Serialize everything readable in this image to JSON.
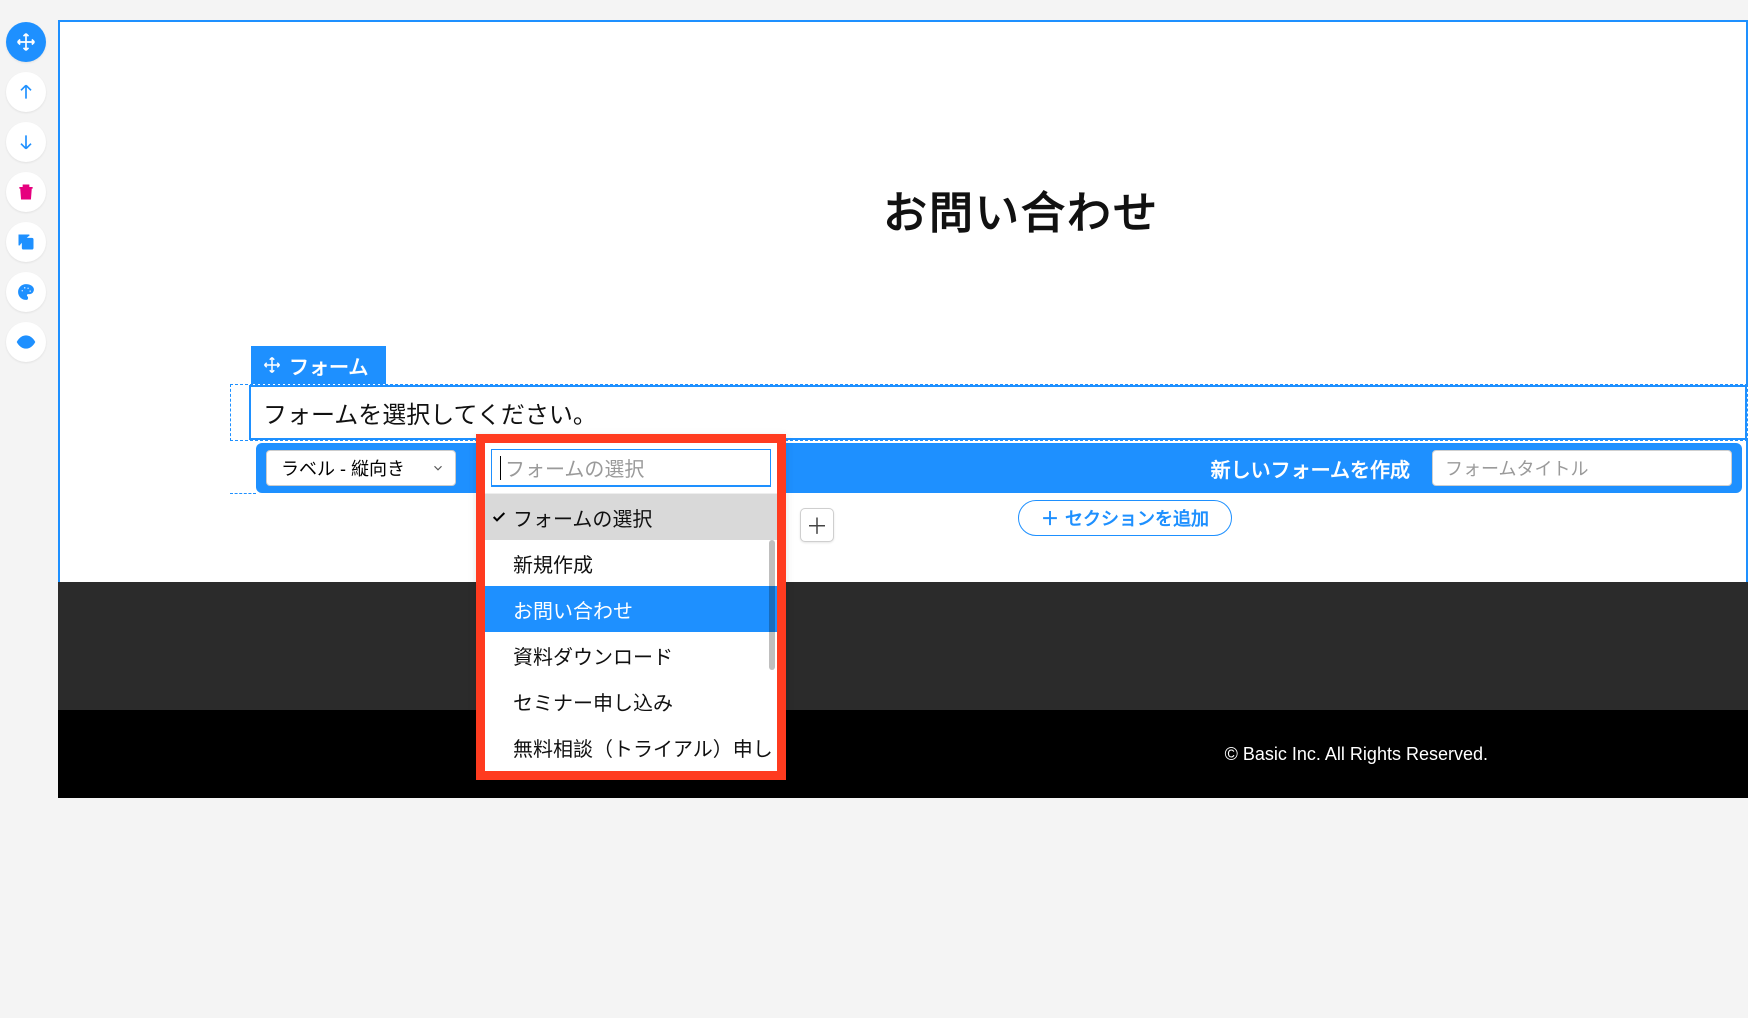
{
  "toolbar": {
    "move": "移動",
    "up": "上へ",
    "down": "下へ",
    "delete": "削除",
    "copy": "コピー",
    "palette": "スタイル",
    "visibility": "表示"
  },
  "page": {
    "heading": "お問い合わせ"
  },
  "element": {
    "tag_label": "フォーム",
    "placeholder_text": "フォームを選択してください。"
  },
  "config": {
    "label_orientation": "ラベル - 縦向き",
    "form_filter_placeholder": "フォームの選択",
    "new_form_label": "新しいフォームを作成",
    "title_placeholder": "フォームタイトル"
  },
  "dropdown": {
    "header": "フォームの選択",
    "options": [
      "新規作成",
      "お問い合わせ",
      "資料ダウンロード",
      "セミナー申し込み",
      "無料相談（トライアル）申し"
    ],
    "highlighted_index": 1
  },
  "actions": {
    "add_section": "セクションを追加"
  },
  "footer": {
    "copyright": "© Basic Inc. All Rights Reserved."
  }
}
